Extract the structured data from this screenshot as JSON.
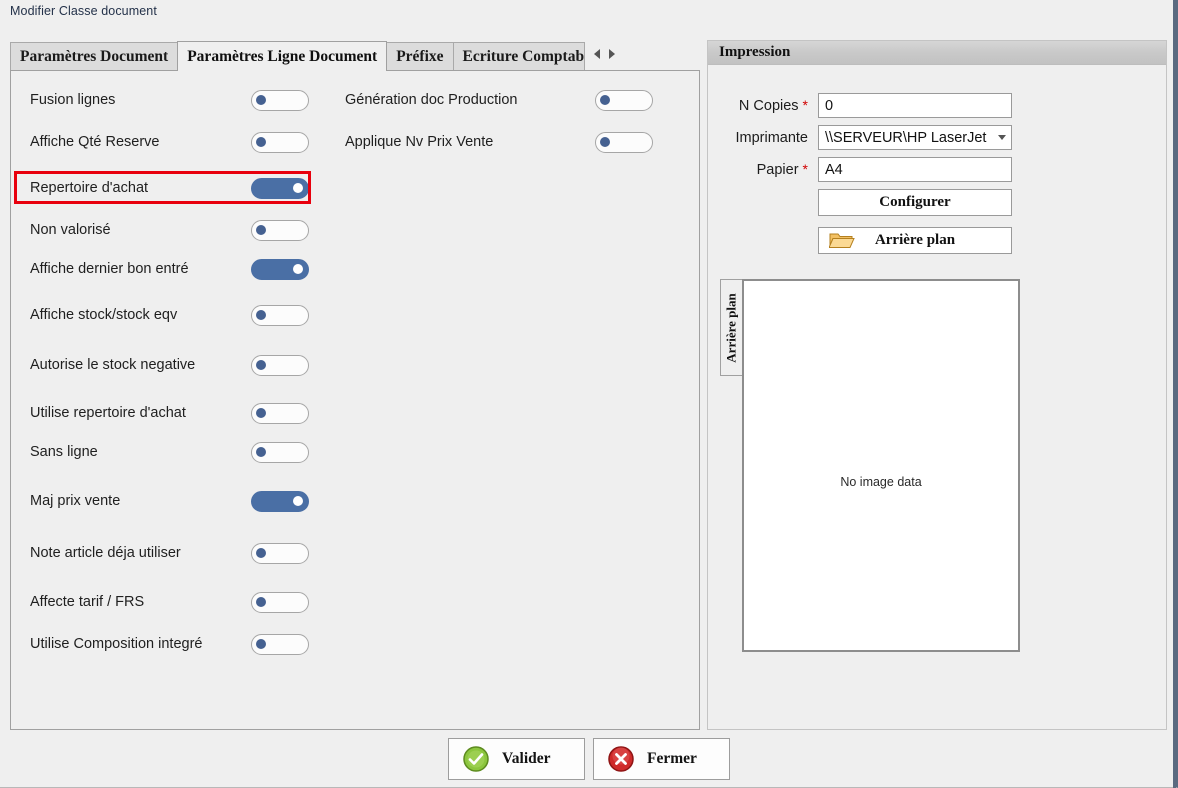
{
  "window": {
    "title": "Modifier Classe document"
  },
  "tabs": [
    {
      "label": "Paramètres Document",
      "selected": false
    },
    {
      "label": "Paramètres Ligne Document",
      "selected": true
    },
    {
      "label": "Préfixe",
      "selected": false
    },
    {
      "label": "Ecriture Comptable",
      "selected": false,
      "clipped": true
    }
  ],
  "tab_nav": {
    "prev_icon": "triangle-left-icon",
    "next_icon": "triangle-right-icon"
  },
  "settings": {
    "column_left": [
      {
        "label": "Fusion lignes",
        "value": "off"
      },
      {
        "label": "Affiche Qté Reserve",
        "value": "off"
      },
      {
        "label": "Repertoire d'achat",
        "value": "on",
        "highlighted": true
      },
      {
        "label": "Non valorisé",
        "value": "off"
      },
      {
        "label": "Affiche dernier bon entré",
        "value": "on"
      },
      {
        "label": "Affiche stock/stock eqv",
        "value": "off"
      },
      {
        "label": "Autorise le stock negative",
        "value": "off"
      },
      {
        "label": "Utilise repertoire d'achat",
        "value": "off"
      },
      {
        "label": "Sans ligne",
        "value": "off"
      },
      {
        "label": "Maj prix vente",
        "value": "on"
      },
      {
        "label": "Note article déja utiliser",
        "value": "off"
      },
      {
        "label": "Affecte tarif / FRS",
        "value": "off"
      },
      {
        "label": "Utilise Composition integré",
        "value": "off"
      }
    ],
    "column_right": [
      {
        "label": "Génération doc Production",
        "value": "off"
      },
      {
        "label": "Applique Nv Prix Vente",
        "value": "off"
      }
    ]
  },
  "impression": {
    "header": "Impression",
    "fields": {
      "copies_label": "N Copies",
      "copies_required": "*",
      "copies_value": "0",
      "printer_label": "Imprimante",
      "printer_value": "\\\\SERVEUR\\HP LaserJet",
      "paper_label": "Papier",
      "paper_required": "*",
      "paper_value": "A4"
    },
    "configure_button": "Configurer",
    "background_button": "Arrière plan",
    "background_icon": "folder-open-icon",
    "preview": {
      "vertical_tab": "Arrière plan",
      "empty_text": "No image data"
    }
  },
  "footer": {
    "validate_label": "Valider",
    "validate_icon": "check-circle-icon",
    "close_label": "Fermer",
    "close_icon": "x-circle-icon"
  },
  "colors": {
    "toggle_on": "#4a6fa5",
    "toggle_off_dot": "#456191",
    "highlight": "#e8000d",
    "required": "#d00000",
    "validate_green": "#7cb342",
    "close_red": "#cc2222",
    "panel_bg": "#efefef"
  }
}
